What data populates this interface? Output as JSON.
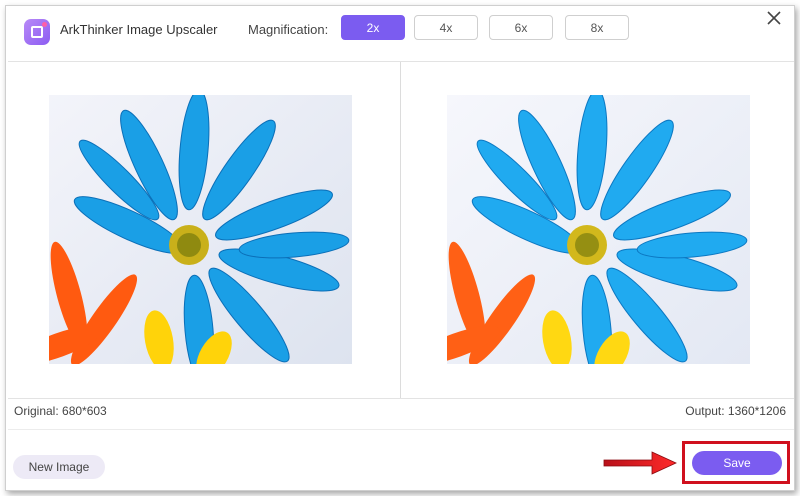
{
  "app": {
    "title": "ArkThinker Image Upscaler",
    "icon": "image-upscaler-app-icon"
  },
  "magnification": {
    "label": "Magnification:",
    "options": [
      "2x",
      "4x",
      "6x",
      "8x"
    ],
    "selected": "2x"
  },
  "preview": {
    "original_label": "Original: 680*603",
    "output_label": "Output: 1360*1206",
    "original_image": "blue-daisy-photo",
    "output_image": "blue-daisy-photo-upscaled"
  },
  "actions": {
    "new_image": "New Image",
    "save": "Save"
  },
  "colors": {
    "accent": "#7b5cf0",
    "highlight_box": "#d0101e",
    "arrow": "#e8141c"
  }
}
